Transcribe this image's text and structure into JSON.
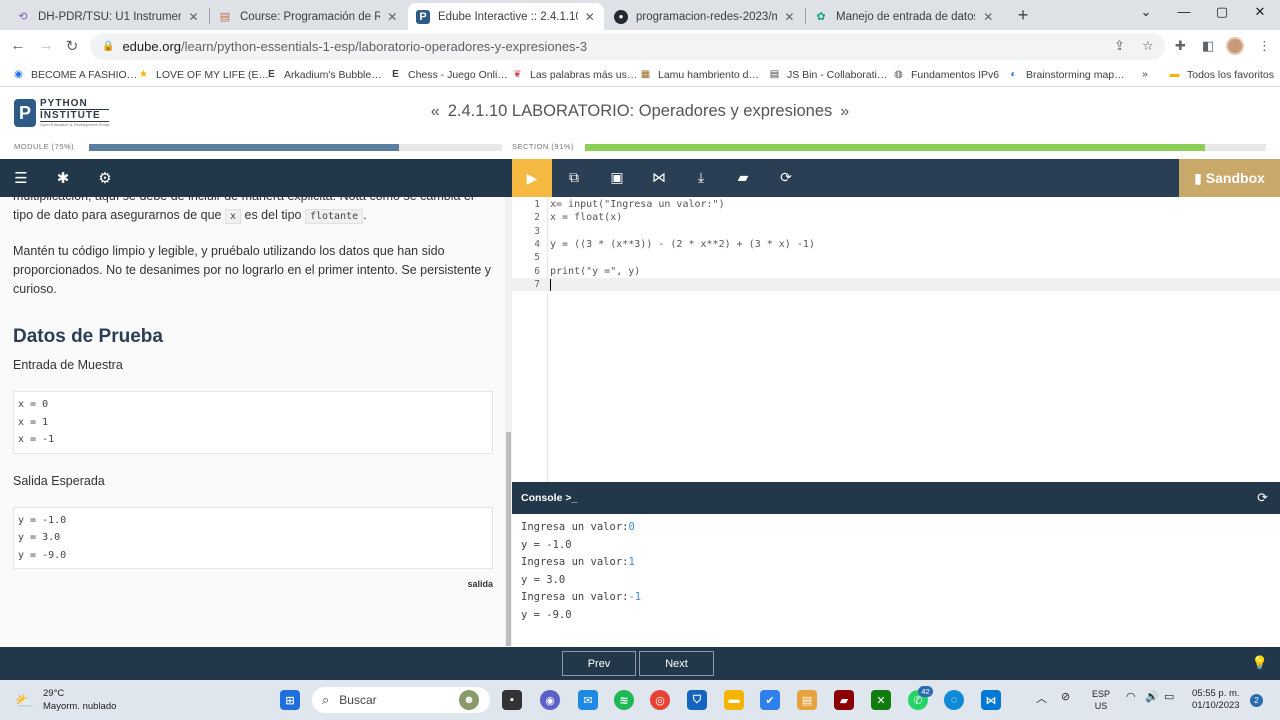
{
  "browser": {
    "tabs": [
      {
        "title": "DH-PDR/TSU: U1 Instrumento d…",
        "active": false
      },
      {
        "title": "Course: Programación de Redes",
        "active": false
      },
      {
        "title": "Edube Interactive :: 2.4.1.10 LAB…",
        "active": true
      },
      {
        "title": "programacion-redes-2023/mod…",
        "active": false
      },
      {
        "title": "Manejo de entrada de datos",
        "active": false
      }
    ],
    "url_domain": "edube.org",
    "url_path": "/learn/python-essentials-1-esp/laboratorio-operadores-y-expresiones-3",
    "bookmarks": [
      "BECOME A FASHIO…",
      "LOVE OF MY LIFE (E…",
      "Arkadium's Bubble…",
      "Chess - Juego Onli…",
      "Las palabras más us…",
      "Lamu hambriento d…",
      "JS Bin - Collaborati…",
      "Fundamentos IPv6",
      "Brainstorming map…"
    ],
    "bookmarks_more": "»",
    "all_bookmarks": "Todos los favoritos"
  },
  "header": {
    "logo_line1": "PYTHON",
    "logo_line2": "INSTITUTE",
    "logo_line3": "Open Education & Development Group",
    "prev_arrow": "«",
    "title": "2.4.1.10 LABORATORIO: Operadores y expresiones",
    "next_arrow": "»"
  },
  "progress": {
    "module_label": "MODULE (75%)",
    "module_value": 0.75,
    "section_label": "SECTION (91%)",
    "section_value": 0.91,
    "module_color": "#5b7ea1",
    "section_color": "#8ccf57"
  },
  "lesson": {
    "para1_a": "multiplicación, aquí se debe de incluir de manera explicita. Nota como se cambia el tipo de dato para asegurarnos de que",
    "para1_code1": "x",
    "para1_b": "es del tipo",
    "para1_code2": "flotante",
    "para1_c": ".",
    "para2": "Mantén tu código limpio y legible, y pruébalo utilizando los datos que han sido proporcionados. No te desanimes por no lograrlo en el primer intento. Se persistente y curioso.",
    "test_heading": "Datos de Prueba",
    "input_heading": "Entrada de Muestra",
    "input_lines": [
      "x = 0",
      "x = 1",
      "x = -1"
    ],
    "output_heading": "Salida Esperada",
    "output_lines": [
      "y = -1.0",
      "y = 3.0",
      "y = -9.0"
    ],
    "output_tag": "salida"
  },
  "editor": {
    "sandbox_label": "Sandbox",
    "lines": [
      {
        "n": "1",
        "code": "x= input(\"Ingresa un valor:\")"
      },
      {
        "n": "2",
        "code": "x = float(x)"
      },
      {
        "n": "3",
        "code": ""
      },
      {
        "n": "4",
        "code": "y = ((3 * (x**3)) - (2 * x**2) + (3 * x) -1)"
      },
      {
        "n": "5",
        "code": ""
      },
      {
        "n": "6",
        "code": "print(\"y =\", y)"
      },
      {
        "n": "7",
        "code": ""
      }
    ]
  },
  "console": {
    "title": "Console >_",
    "lines": [
      {
        "prompt": "Ingresa un valor:",
        "input": "0"
      },
      {
        "prompt": "y = -1.0",
        "input": ""
      },
      {
        "prompt": "Ingresa un valor:",
        "input": "1"
      },
      {
        "prompt": "y = 3.0",
        "input": ""
      },
      {
        "prompt": "Ingresa un valor:",
        "input": "-1"
      },
      {
        "prompt": "y = -9.0",
        "input": ""
      }
    ]
  },
  "footer": {
    "prev_label": "Prev",
    "next_label": "Next"
  },
  "taskbar": {
    "temp": "29°C",
    "weather": "Mayorm. nublado",
    "search_placeholder": "Buscar",
    "whatsapp_badge": "42",
    "lang_line1": "ESP",
    "lang_line2": "US",
    "time": "05:55 p. m.",
    "date": "01/10/2023",
    "notif_count": "2"
  }
}
